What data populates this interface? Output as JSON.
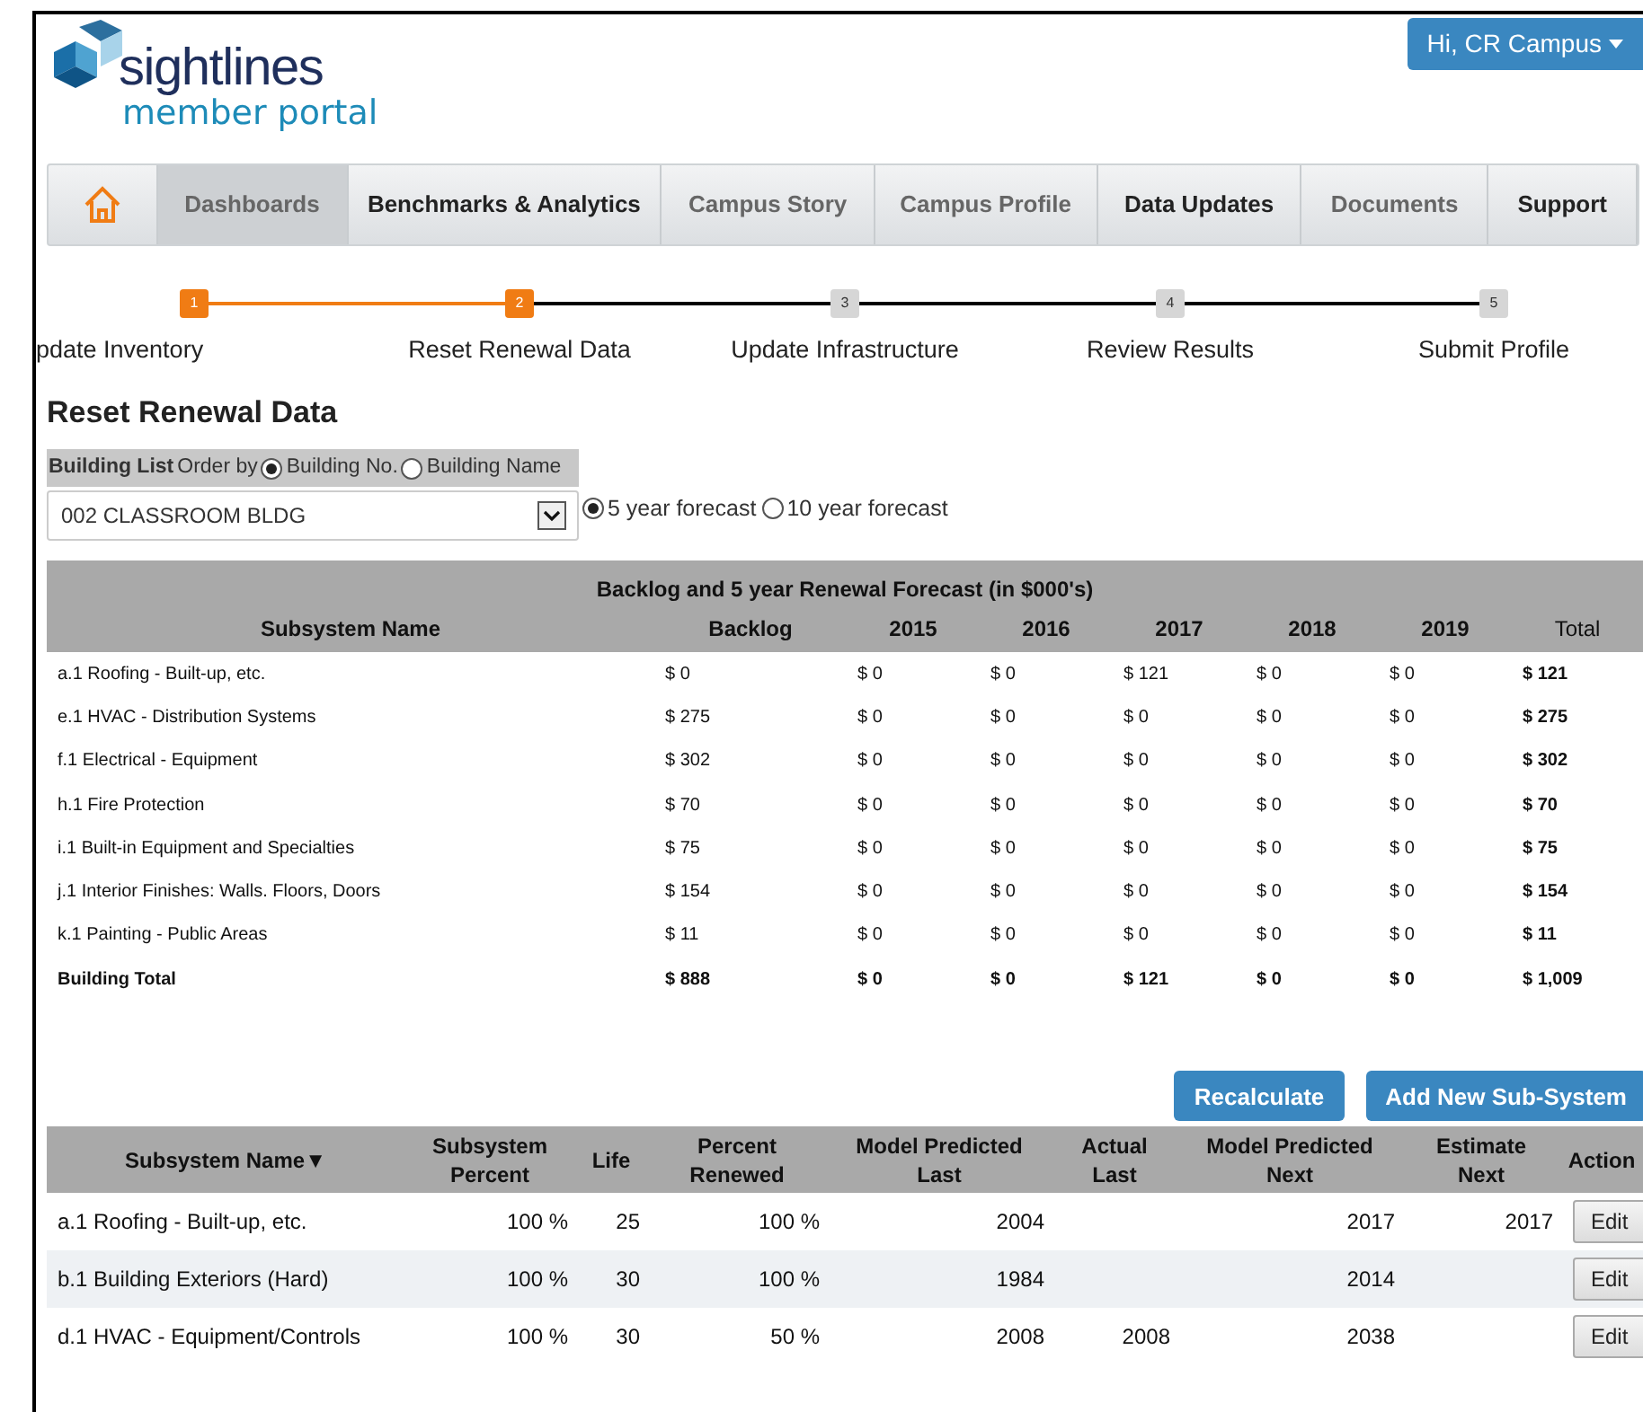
{
  "header": {
    "logo": {
      "name": "sightlines",
      "tagline": "member portal"
    },
    "user_menu": "Hi, CR Campus"
  },
  "nav": [
    {
      "label": "Dashboards",
      "selected": true,
      "bold": false
    },
    {
      "label": "Benchmarks & Analytics",
      "selected": false,
      "bold": true
    },
    {
      "label": "Campus Story",
      "selected": false,
      "bold": false
    },
    {
      "label": "Campus Profile",
      "selected": false,
      "bold": false
    },
    {
      "label": "Data Updates",
      "selected": false,
      "bold": true
    },
    {
      "label": "Documents",
      "selected": false,
      "bold": false
    },
    {
      "label": "Support",
      "selected": false,
      "bold": true
    }
  ],
  "steps": [
    {
      "number": "1",
      "label": "pdate Inventory",
      "done": true
    },
    {
      "number": "2",
      "label": "Reset Renewal Data",
      "done": true
    },
    {
      "number": "3",
      "label": "Update Infrastructure",
      "done": false
    },
    {
      "number": "4",
      "label": "Review Results",
      "done": false
    },
    {
      "number": "5",
      "label": "Submit Profile",
      "done": false
    }
  ],
  "page_title": "Reset Renewal Data",
  "building_list": {
    "label": "Building List",
    "order_by": "Order by",
    "options": [
      {
        "label": "Building No.",
        "selected": true
      },
      {
        "label": "Building Name",
        "selected": false
      }
    ]
  },
  "building_select": {
    "value": "002 CLASSROOM BLDG"
  },
  "forecast_options": [
    {
      "label": "5 year forecast",
      "selected": true
    },
    {
      "label": "10 year forecast",
      "selected": false
    }
  ],
  "backlog_table": {
    "title": "Backlog and 5 year Renewal Forecast (in $000's)",
    "columns": [
      "Subsystem Name",
      "Backlog",
      "2015",
      "2016",
      "2017",
      "2018",
      "2019",
      "Total"
    ],
    "rows": [
      {
        "kind": "item",
        "cells": [
          "a.1 Roofing - Built-up, etc.",
          "$ 0",
          "$ 0",
          "$ 0",
          "$ 121",
          "$ 0",
          "$ 0",
          "$ 121"
        ]
      },
      {
        "kind": "item",
        "cells": [
          "e.1 HVAC - Distribution Systems",
          "$ 275",
          "$ 0",
          "$ 0",
          "$ 0",
          "$ 0",
          "$ 0",
          "$ 275"
        ]
      },
      {
        "kind": "item",
        "cells": [
          "f.1 Electrical - Equipment",
          "$ 302",
          "$ 0",
          "$ 0",
          "$ 0",
          "$ 0",
          "$ 0",
          "$ 302"
        ]
      },
      {
        "kind": "item",
        "cells": [
          "h.1 Fire Protection",
          "$ 70",
          "$ 0",
          "$ 0",
          "$ 0",
          "$ 0",
          "$ 0",
          "$ 70"
        ]
      },
      {
        "kind": "item",
        "cells": [
          "i.1 Built-in Equipment and Specialties",
          "$ 75",
          "$ 0",
          "$ 0",
          "$ 0",
          "$ 0",
          "$ 0",
          "$ 75"
        ]
      },
      {
        "kind": "item",
        "cells": [
          "j.1 Interior Finishes: Walls. Floors, Doors",
          "$ 154",
          "$ 0",
          "$ 0",
          "$ 0",
          "$ 0",
          "$ 0",
          "$ 154"
        ]
      },
      {
        "kind": "item",
        "cells": [
          "k.1 Painting - Public Areas",
          "$ 11",
          "$ 0",
          "$ 0",
          "$ 0",
          "$ 0",
          "$ 0",
          "$ 11"
        ]
      },
      {
        "kind": "total",
        "cells": [
          "Building Total",
          "$ 888",
          "$ 0",
          "$ 0",
          "$ 121",
          "$ 0",
          "$ 0",
          "$ 1,009"
        ]
      }
    ]
  },
  "buttons": [
    "Recalculate",
    "Add New Sub-System"
  ],
  "subsystem_table": {
    "columns": [
      "Subsystem Name▼",
      "Subsystem Percent",
      "Life",
      "Percent Renewed",
      "Model Predicted Last",
      "Actual Last",
      "Model Predicted Next",
      "Estimate Next",
      "Action"
    ],
    "rows": [
      {
        "cells": [
          "a.1 Roofing - Built-up, etc.",
          "100 %",
          "25",
          "100 %",
          "2004",
          "",
          "2017",
          "2017"
        ],
        "action": "Edit"
      },
      {
        "cells": [
          "b.1 Building Exteriors (Hard)",
          "100 %",
          "30",
          "100 %",
          "1984",
          "",
          "2014",
          ""
        ],
        "action": "Edit"
      },
      {
        "cells": [
          "d.1 HVAC - Equipment/Controls",
          "100 %",
          "30",
          "50 %",
          "2008",
          "2008",
          "2038",
          ""
        ],
        "action": "Edit"
      }
    ]
  }
}
